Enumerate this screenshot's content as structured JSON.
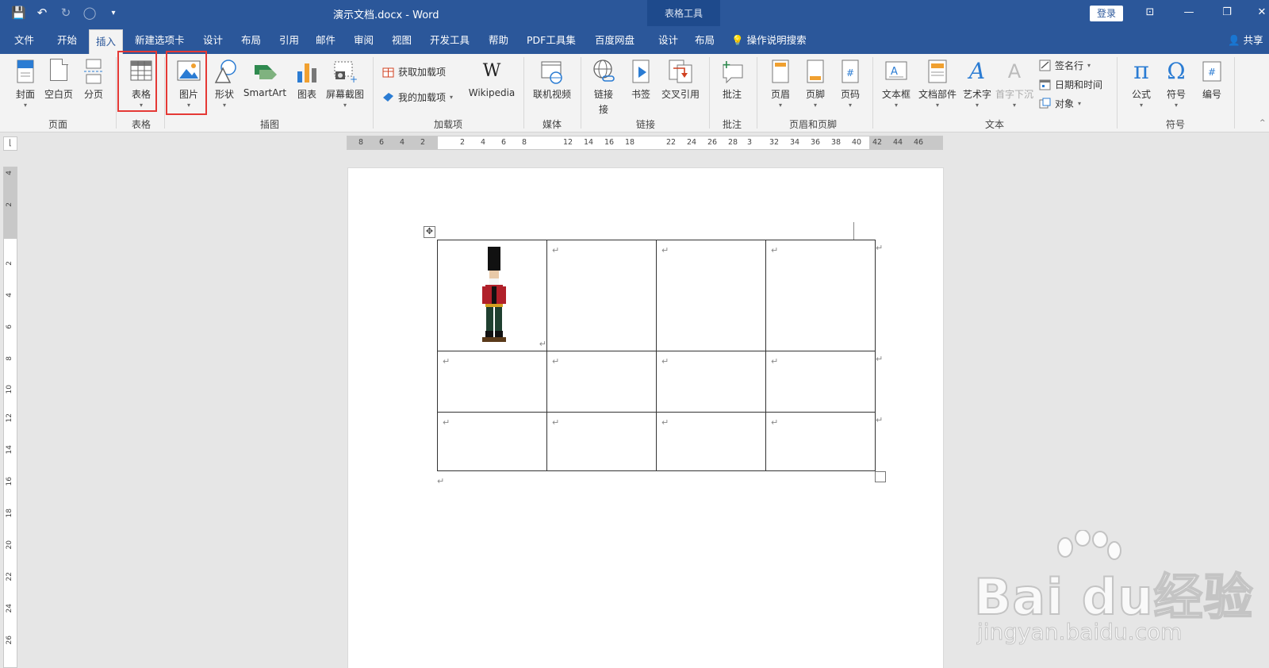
{
  "window": {
    "title": "演示文档.docx  -  Word",
    "context_tools": "表格工具",
    "login": "登录"
  },
  "tabs": [
    "文件",
    "开始",
    "插入",
    "新建选项卡",
    "设计",
    "布局",
    "引用",
    "邮件",
    "审阅",
    "视图",
    "开发工具",
    "帮助",
    "PDF工具集",
    "百度网盘",
    "设计",
    "布局"
  ],
  "active_tab": "插入",
  "search_label": "操作说明搜索",
  "share_label": "共享",
  "ribbon": {
    "pages": {
      "cover": "封面",
      "blank": "空白页",
      "page_break": "分页",
      "group": "页面"
    },
    "tables": {
      "table": "表格",
      "group": "表格"
    },
    "illustrations": {
      "picture": "图片",
      "shapes": "形状",
      "smartart": "SmartArt",
      "chart": "图表",
      "screenshot": "屏幕截图",
      "group": "插图"
    },
    "addins": {
      "get": "获取加载项",
      "mine": "我的加载项",
      "wikipedia": "Wikipedia",
      "group": "加载项"
    },
    "media": {
      "online_video": "联机视频",
      "group": "媒体"
    },
    "links": {
      "link": "链接",
      "link_sub": "接",
      "bookmark": "书签",
      "cross_ref": "交叉引用",
      "group": "链接"
    },
    "comments": {
      "comment": "批注",
      "group": "批注"
    },
    "header_footer": {
      "header": "页眉",
      "footer": "页脚",
      "page_number": "页码",
      "group": "页眉和页脚"
    },
    "text": {
      "textbox": "文本框",
      "quick_parts": "文档部件",
      "wordart": "艺术字",
      "drop_cap": "首字下沉",
      "signature": "签名行",
      "datetime": "日期和时间",
      "object": "对象",
      "group": "文本"
    },
    "symbols": {
      "equation": "公式",
      "symbol": "符号",
      "number": "编号",
      "group": "符号"
    }
  },
  "ruler": {
    "horizontal_ticks": [
      "8",
      "6",
      "4",
      "2",
      "2",
      "4",
      "6",
      "8",
      "12",
      "14",
      "16",
      "18",
      "22",
      "24",
      "26",
      "28",
      "3",
      "32",
      "34",
      "36",
      "38",
      "40",
      "42",
      "44",
      "46"
    ],
    "vertical_ticks": [
      "4",
      "2",
      "2",
      "4",
      "6",
      "8",
      "10",
      "12",
      "14",
      "16",
      "18",
      "20",
      "22",
      "24",
      "26"
    ]
  },
  "document": {
    "paragraph_mark": "↵",
    "table_rows": 3,
    "table_cols": 4
  },
  "watermark": {
    "main": "Bai du经验",
    "sub": "jingyan.baidu.com"
  },
  "colors": {
    "accent": "#2b579a",
    "highlight": "#e53935"
  }
}
